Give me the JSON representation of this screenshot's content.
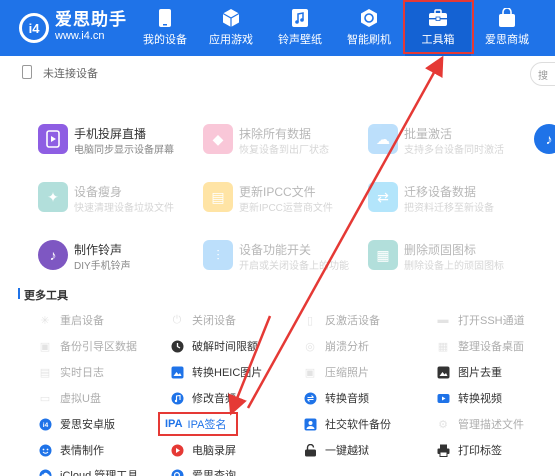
{
  "app": {
    "brand_name": "爱思助手",
    "brand_url": "www.i4.cn",
    "logo_text": "i4"
  },
  "nav": [
    {
      "label": "我的设备",
      "icon": "phone-icon"
    },
    {
      "label": "应用游戏",
      "icon": "cube-icon"
    },
    {
      "label": "铃声壁纸",
      "icon": "music-file-icon"
    },
    {
      "label": "智能刷机",
      "icon": "refresh-icon"
    },
    {
      "label": "工具箱",
      "icon": "toolbox-icon",
      "active": true
    },
    {
      "label": "爱思商城",
      "icon": "shopping-bag-icon"
    }
  ],
  "status": {
    "text": "未连接设备",
    "search_placeholder": "搜"
  },
  "cards": [
    {
      "title": "手机投屏直播",
      "sub": "电脑同步显示设备屏幕",
      "icon": "screen-mirror-icon",
      "color": "#8e5ee3",
      "faded": false
    },
    {
      "title": "抹除所有数据",
      "sub": "恢复设备到出厂状态",
      "icon": "erase-icon",
      "color": "#f06292",
      "faded": true
    },
    {
      "title": "批量激活",
      "sub": "支持多台设备同时激活",
      "icon": "activate-icon",
      "color": "#42a5f5",
      "faded": true
    },
    {
      "title": "设备瘦身",
      "sub": "快速清理设备垃圾文件",
      "icon": "broom-icon",
      "color": "#26a69a",
      "faded": true
    },
    {
      "title": "更新IPCC文件",
      "sub": "更新IPCC运营商文件",
      "icon": "folder-icon",
      "color": "#ffb300",
      "faded": true
    },
    {
      "title": "迁移设备数据",
      "sub": "把资料迁移至新设备",
      "icon": "migrate-icon",
      "color": "#29b6f6",
      "faded": true
    },
    {
      "title": "制作铃声",
      "sub": "DIY手机铃声",
      "icon": "music-note-icon",
      "color": "#7e57c2",
      "faded": false
    },
    {
      "title": "设备功能开关",
      "sub": "开启或关闭设备上的功能",
      "icon": "sliders-icon",
      "color": "#42a5f5",
      "faded": true
    },
    {
      "title": "删除顽固图标",
      "sub": "删除设备上的顽固图标",
      "icon": "grid-delete-icon",
      "color": "#26a69a",
      "faded": true
    }
  ],
  "section_title": "更多工具",
  "tools": [
    {
      "label": "重启设备",
      "icon": "restart-icon",
      "color": "#bbb",
      "faded": true
    },
    {
      "label": "关闭设备",
      "icon": "power-icon",
      "color": "#bbb",
      "faded": true
    },
    {
      "label": "反激活设备",
      "icon": "deactivate-icon",
      "color": "#bbb",
      "faded": true
    },
    {
      "label": "打开SSH通道",
      "icon": "ssh-icon",
      "color": "#bbb",
      "faded": true
    },
    {
      "label": "备份引导区数据",
      "icon": "backup-icon",
      "color": "#bbb",
      "faded": true
    },
    {
      "label": "破解时间限额",
      "icon": "clock-icon",
      "color": "#333",
      "faded": false
    },
    {
      "label": "崩溃分析",
      "icon": "crash-icon",
      "color": "#bbb",
      "faded": true
    },
    {
      "label": "整理设备桌面",
      "icon": "desktop-icon",
      "color": "#bbb",
      "faded": true
    },
    {
      "label": "实时日志",
      "icon": "log-icon",
      "color": "#bbb",
      "faded": true
    },
    {
      "label": "转换HEIC图片",
      "icon": "heic-icon",
      "color": "#1f73e8",
      "faded": false
    },
    {
      "label": "压缩照片",
      "icon": "compress-icon",
      "color": "#bbb",
      "faded": true
    },
    {
      "label": "图片去重",
      "icon": "image-icon",
      "color": "#333",
      "faded": false
    },
    {
      "label": "虚拟U盘",
      "icon": "usb-icon",
      "color": "#bbb",
      "faded": true
    },
    {
      "label": "修改音频",
      "icon": "audio-icon",
      "color": "#1f73e8",
      "faded": false
    },
    {
      "label": "转换音频",
      "icon": "convert-audio-icon",
      "color": "#1f73e8",
      "faded": false
    },
    {
      "label": "转换视频",
      "icon": "video-icon",
      "color": "#1f73e8",
      "faded": false
    },
    {
      "label": "爱思安卓版",
      "icon": "android-icon",
      "color": "#1f73e8",
      "faded": false
    },
    {
      "label": "IPA签名",
      "icon": "ipa-icon",
      "color": "#1f73e8",
      "faded": false
    },
    {
      "label": "社交软件备份",
      "icon": "social-backup-icon",
      "color": "#1f73e8",
      "faded": false
    },
    {
      "label": "管理描述文件",
      "icon": "profile-icon",
      "color": "#bbb",
      "faded": true
    },
    {
      "label": "表情制作",
      "icon": "emoji-icon",
      "color": "#1f73e8",
      "faded": false
    },
    {
      "label": "电脑录屏",
      "icon": "record-icon",
      "color": "#e53935",
      "faded": false
    },
    {
      "label": "一键越狱",
      "icon": "jailbreak-icon",
      "color": "#333",
      "faded": false
    },
    {
      "label": "打印标签",
      "icon": "print-icon",
      "color": "#333",
      "faded": false
    },
    {
      "label": "iCloud 管理工具",
      "icon": "icloud-icon",
      "color": "#1f73e8",
      "faded": false
    },
    {
      "label": "爱思查询",
      "icon": "query-icon",
      "color": "#1f73e8",
      "faded": false
    }
  ],
  "ipa_glyph": "IPA",
  "annotation_color": "#e53935",
  "accent": "#1f73e8"
}
